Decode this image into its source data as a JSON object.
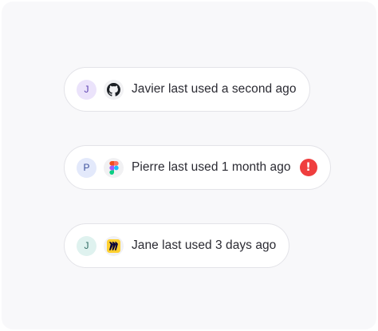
{
  "items": [
    {
      "avatar_initial": "J",
      "avatar_bg": "#ebe3fb",
      "avatar_color": "#5b3fb0",
      "app_icon": "github-icon",
      "text": "Javier last used a second ago",
      "has_alert": false
    },
    {
      "avatar_initial": "P",
      "avatar_bg": "#e3e9fb",
      "avatar_color": "#3b4f9a",
      "app_icon": "figma-icon",
      "text": "Pierre last used 1 month ago",
      "has_alert": true,
      "alert_icon": "exclamation-icon",
      "alert_symbol": "!",
      "alert_color": "#ef3e3e"
    },
    {
      "avatar_initial": "J",
      "avatar_bg": "#dff2ef",
      "avatar_color": "#2f6b63",
      "app_icon": "miro-icon",
      "text": "Jane last used 3 days ago",
      "has_alert": false
    }
  ]
}
